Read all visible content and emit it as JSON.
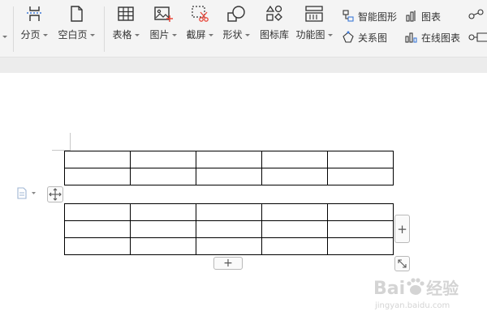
{
  "toolbar": {
    "page_break": "分页",
    "blank_page": "空白页",
    "table": "表格",
    "picture": "图片",
    "screenshot": "截屏",
    "shape": "形状",
    "icon_library": "图标库",
    "function_chart": "功能图",
    "smart_graphic": "智能图形",
    "relationship_chart": "关系图",
    "chart": "图表",
    "online_chart": "在线图表"
  },
  "table_controls": {
    "add_column_symbol": "+",
    "add_row_symbol": "+"
  },
  "watermark": {
    "brand": "Bai",
    "brand_suffix": "经验",
    "url": "jingyan.baidu.com"
  },
  "colors": {
    "ribbon_bg": "#f4f4f4",
    "icon_blue": "#3b78d8",
    "icon_red": "#e8483b"
  }
}
